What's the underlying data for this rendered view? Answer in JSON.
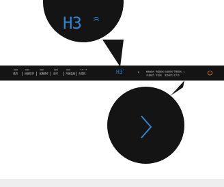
{
  "control_panel": {
    "buttons": [
      {
        "label": "强烈"
      },
      {
        "label": "闭锁防护"
      },
      {
        "label": "北魏操作"
      },
      {
        "label": "定时"
      },
      {
        "label": "开锁温度"
      },
      {
        "label": "去湿机"
      }
    ],
    "small_numbers": "1-8  ↑3",
    "display_value": "H3",
    "display_superscript": "°",
    "modes": [
      {
        "label": "制热模式"
      },
      {
        "label": "降温模式"
      },
      {
        "label": "化霜模式"
      },
      {
        "label": "节能模式"
      },
      {
        "label": "水温模式"
      },
      {
        "label": "水温机"
      },
      {
        "label": "加热模式"
      },
      {
        "label": "北大水"
      }
    ]
  },
  "zoom_callouts": {
    "display_value": "H3"
  },
  "colors": {
    "panel": "#141414",
    "accent_blue": "#2d86d2",
    "power_orange": "#e07a1a"
  }
}
